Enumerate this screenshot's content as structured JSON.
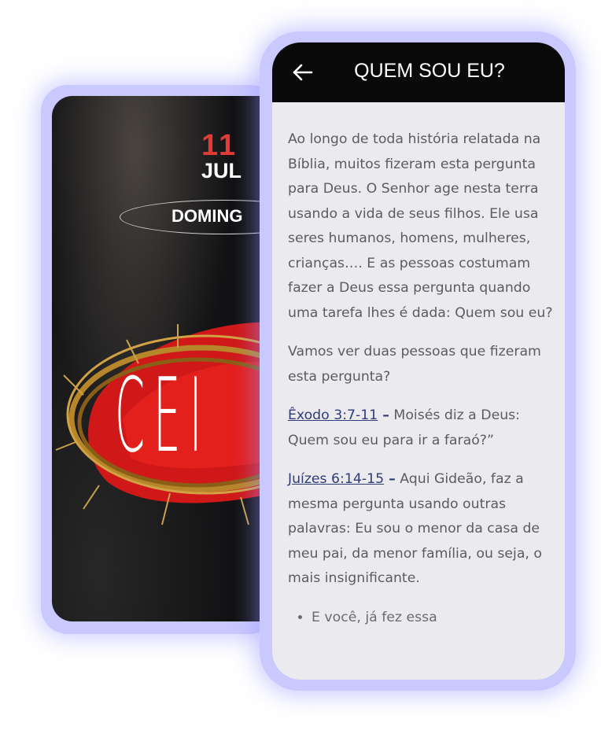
{
  "back_phone": {
    "day": "11",
    "month": "JUL",
    "weekday": "DOMING",
    "art_title": "CEI"
  },
  "front_phone": {
    "title": "QUEM SOU EU?",
    "intro": "Ao longo de toda história relatada na Bíblia, muitos fizeram esta pergunta para Deus. O Senhor age nesta terra usando a vida de seus filhos.  Ele usa seres humanos, homens, mulheres, crianças…. E as pessoas costumam fazer a Deus essa pergunta quando uma tarefa lhes é dada: Quem sou eu?",
    "lead": "Vamos ver duas pessoas que fizeram esta pergunta?",
    "refs": [
      {
        "ref": "Êxodo 3:7-11",
        "dash": " –",
        "text": " Moisés diz a Deus: Quem sou eu para ir a faraó?”"
      },
      {
        "ref": "Juízes 6:14-15",
        "dash": " –",
        "text": " Aqui Gideão, faz a mesma pergunta usando outras palavras: Eu sou o menor da casa de meu pai, da menor família, ou seja, o mais insignificante."
      }
    ],
    "bullet": "E você, já fez essa"
  }
}
